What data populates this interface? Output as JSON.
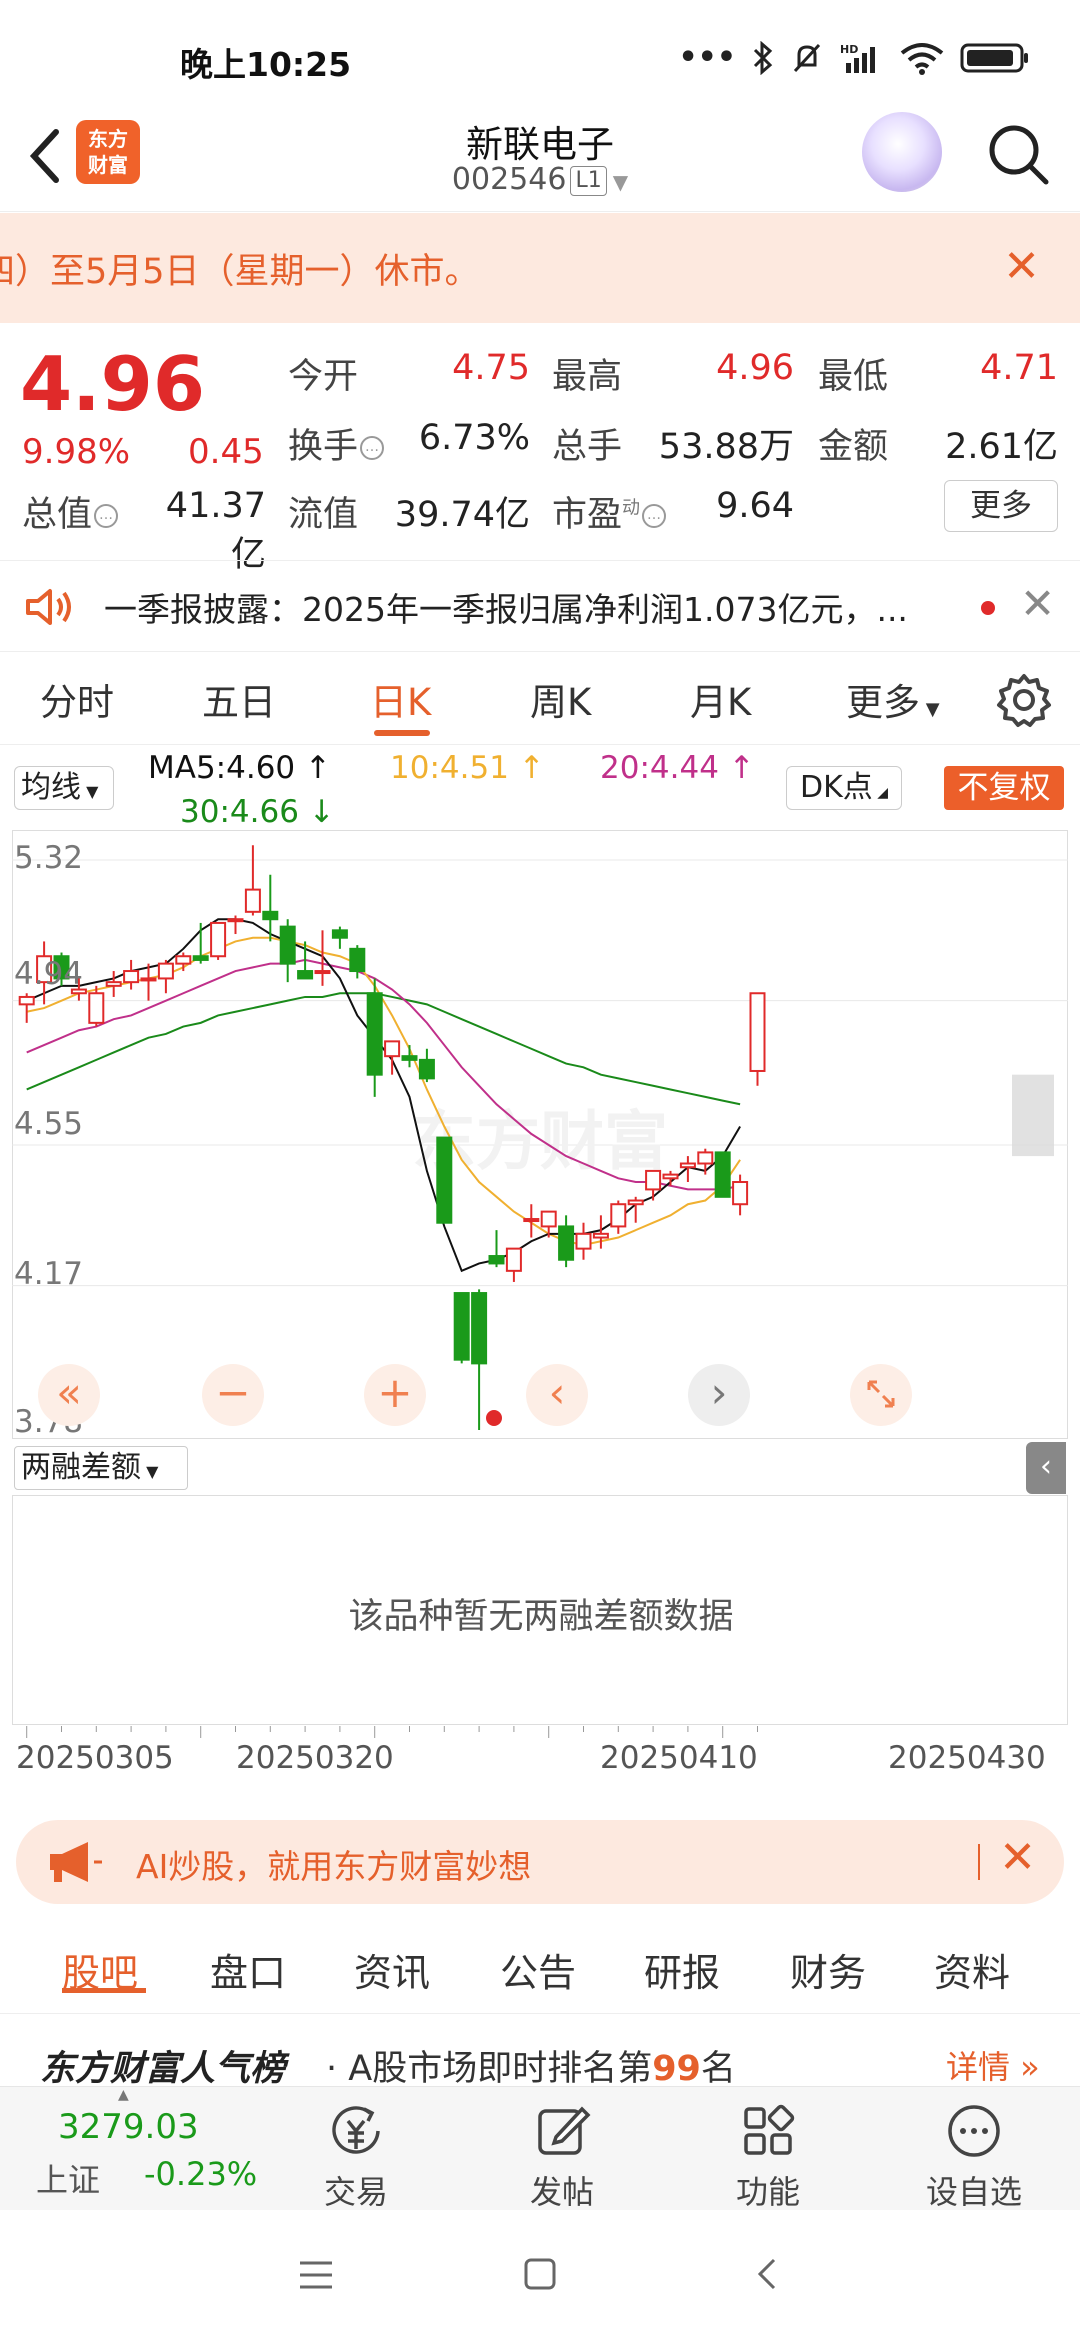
{
  "status": {
    "time": "晚上10:25"
  },
  "header": {
    "title": "新联电子",
    "code": "002546",
    "level": "L1",
    "logo_line1": "东方",
    "logo_line2": "财富"
  },
  "notice": {
    "text": "四）至5月5日（星期一）休市。"
  },
  "quote": {
    "price": "4.96",
    "change_pct": "9.98%",
    "change": "0.45",
    "open_label": "今开",
    "open": "4.75",
    "high_label": "最高",
    "high": "4.96",
    "low_label": "最低",
    "low": "4.71",
    "turnover_label": "换手",
    "turnover": "6.73%",
    "volume_label": "总手",
    "volume": "53.88万",
    "amount_label": "金额",
    "amount": "2.61亿",
    "mktcap_label": "总值",
    "mktcap": "41.37亿",
    "float_label": "流值",
    "float": "39.74亿",
    "pe_label": "市盈",
    "pe_sup": "动",
    "pe": "9.64",
    "more": "更多"
  },
  "news": {
    "text": "一季报披露：2025年一季报归属净利润1.073亿元，..."
  },
  "ktabs": [
    "分时",
    "五日",
    "日K",
    "周K",
    "月K",
    "更多"
  ],
  "ma": {
    "select": "均线",
    "ma5": "MA5:4.60 ↑",
    "ma10": "10:4.51 ↑",
    "ma20": "20:4.44 ↑",
    "ma30": "30:4.66 ↓",
    "dk": "DK点",
    "fq": "不复权"
  },
  "colors": {
    "up": "#e02a2a",
    "down": "#1a9a1a",
    "accent": "#e5602c",
    "ma5": "#111111",
    "ma10": "#f0b030",
    "ma20": "#c0308a",
    "ma30": "#1a8a1a"
  },
  "chart_data": {
    "type": "candlestick",
    "ylim": [
      3.78,
      5.32
    ],
    "y_ticks": [
      "5.32",
      "4.94",
      "4.55",
      "4.17",
      "3.78"
    ],
    "x_ticks": [
      "20250305",
      "20250320",
      "20250410",
      "20250430"
    ],
    "candles": [
      {
        "o": 4.93,
        "h": 4.96,
        "l": 4.88,
        "c": 4.95
      },
      {
        "o": 4.99,
        "h": 5.1,
        "l": 4.93,
        "c": 5.06
      },
      {
        "o": 5.06,
        "h": 5.07,
        "l": 4.98,
        "c": 5.0
      },
      {
        "o": 4.96,
        "h": 5.0,
        "l": 4.94,
        "c": 4.97
      },
      {
        "o": 4.88,
        "h": 4.98,
        "l": 4.87,
        "c": 4.96
      },
      {
        "o": 4.98,
        "h": 5.02,
        "l": 4.95,
        "c": 4.99
      },
      {
        "o": 4.99,
        "h": 5.05,
        "l": 4.97,
        "c": 5.02
      },
      {
        "o": 5.0,
        "h": 5.04,
        "l": 4.94,
        "c": 5.0
      },
      {
        "o": 5.0,
        "h": 5.05,
        "l": 4.96,
        "c": 5.04
      },
      {
        "o": 5.04,
        "h": 5.07,
        "l": 5.02,
        "c": 5.06
      },
      {
        "o": 5.06,
        "h": 5.15,
        "l": 5.04,
        "c": 5.05
      },
      {
        "o": 5.06,
        "h": 5.15,
        "l": 5.05,
        "c": 5.15
      },
      {
        "o": 5.16,
        "h": 5.17,
        "l": 5.12,
        "c": 5.16
      },
      {
        "o": 5.18,
        "h": 5.36,
        "l": 5.17,
        "c": 5.24
      },
      {
        "o": 5.18,
        "h": 5.28,
        "l": 5.1,
        "c": 5.16
      },
      {
        "o": 5.14,
        "h": 5.16,
        "l": 4.99,
        "c": 5.04
      },
      {
        "o": 5.02,
        "h": 5.1,
        "l": 5.0,
        "c": 5.0
      },
      {
        "o": 5.02,
        "h": 5.13,
        "l": 4.98,
        "c": 5.02
      },
      {
        "o": 5.13,
        "h": 5.14,
        "l": 5.08,
        "c": 5.11
      },
      {
        "o": 5.08,
        "h": 5.09,
        "l": 5.0,
        "c": 5.02
      },
      {
        "o": 4.96,
        "h": 5.0,
        "l": 4.68,
        "c": 4.74
      },
      {
        "o": 4.79,
        "h": 4.82,
        "l": 4.74,
        "c": 4.83
      },
      {
        "o": 4.79,
        "h": 4.82,
        "l": 4.76,
        "c": 4.78
      },
      {
        "o": 4.78,
        "h": 4.81,
        "l": 4.72,
        "c": 4.73
      },
      {
        "o": 4.57,
        "h": 4.57,
        "l": 4.34,
        "c": 4.34
      },
      {
        "o": 4.15,
        "h": 4.15,
        "l": 3.96,
        "c": 3.97
      },
      {
        "o": 4.15,
        "h": 4.16,
        "l": 3.78,
        "c": 3.96
      },
      {
        "o": 4.25,
        "h": 4.32,
        "l": 4.22,
        "c": 4.23
      },
      {
        "o": 4.21,
        "h": 4.27,
        "l": 4.18,
        "c": 4.27
      },
      {
        "o": 4.35,
        "h": 4.39,
        "l": 4.3,
        "c": 4.35
      },
      {
        "o": 4.33,
        "h": 4.37,
        "l": 4.3,
        "c": 4.37
      },
      {
        "o": 4.33,
        "h": 4.36,
        "l": 4.22,
        "c": 4.24
      },
      {
        "o": 4.27,
        "h": 4.34,
        "l": 4.24,
        "c": 4.31
      },
      {
        "o": 4.3,
        "h": 4.36,
        "l": 4.27,
        "c": 4.31
      },
      {
        "o": 4.33,
        "h": 4.4,
        "l": 4.31,
        "c": 4.39
      },
      {
        "o": 4.39,
        "h": 4.41,
        "l": 4.34,
        "c": 4.4
      },
      {
        "o": 4.43,
        "h": 4.48,
        "l": 4.4,
        "c": 4.48
      },
      {
        "o": 4.46,
        "h": 4.48,
        "l": 4.44,
        "c": 4.47
      },
      {
        "o": 4.49,
        "h": 4.52,
        "l": 4.45,
        "c": 4.5
      },
      {
        "o": 4.5,
        "h": 4.54,
        "l": 4.47,
        "c": 4.53
      },
      {
        "o": 4.53,
        "h": 4.53,
        "l": 4.41,
        "c": 4.41
      },
      {
        "o": 4.39,
        "h": 4.47,
        "l": 4.36,
        "c": 4.45
      },
      {
        "o": 4.75,
        "h": 4.96,
        "l": 4.71,
        "c": 4.96
      }
    ],
    "ma5": [
      4.94,
      4.96,
      4.98,
      4.98,
      4.99,
      5.0,
      5.02,
      5.03,
      5.04,
      5.08,
      5.13,
      5.16,
      5.16,
      5.15,
      5.12,
      5.1,
      5.08,
      5.06,
      5.0,
      4.9,
      4.84,
      4.78,
      4.68,
      4.48,
      4.33,
      4.21,
      4.23,
      4.24,
      4.26,
      4.29,
      4.31,
      4.31,
      4.31,
      4.32,
      4.35,
      4.39,
      4.41,
      4.45,
      4.49,
      4.48,
      4.52,
      4.6
    ],
    "ma10": [
      4.91,
      4.92,
      4.94,
      4.96,
      4.97,
      4.98,
      4.99,
      5.0,
      5.01,
      5.03,
      5.06,
      5.08,
      5.1,
      5.11,
      5.11,
      5.1,
      5.09,
      5.07,
      5.06,
      5.04,
      4.98,
      4.9,
      4.81,
      4.7,
      4.6,
      4.51,
      4.45,
      4.41,
      4.37,
      4.34,
      4.31,
      4.29,
      4.28,
      4.29,
      4.3,
      4.32,
      4.34,
      4.36,
      4.39,
      4.4,
      4.44,
      4.51
    ],
    "ma20": [
      4.8,
      4.82,
      4.84,
      4.86,
      4.87,
      4.89,
      4.9,
      4.92,
      4.94,
      4.96,
      4.98,
      5.0,
      5.02,
      5.03,
      5.04,
      5.04,
      5.05,
      5.04,
      5.03,
      5.02,
      5.0,
      4.97,
      4.93,
      4.88,
      4.82,
      4.76,
      4.71,
      4.66,
      4.62,
      4.58,
      4.55,
      4.52,
      4.5,
      4.48,
      4.46,
      4.45,
      4.45,
      4.44,
      4.43,
      4.43,
      4.43,
      4.44
    ],
    "ma30": [
      4.7,
      4.72,
      4.74,
      4.76,
      4.78,
      4.8,
      4.82,
      4.84,
      4.85,
      4.87,
      4.88,
      4.9,
      4.91,
      4.92,
      4.93,
      4.94,
      4.95,
      4.95,
      4.96,
      4.96,
      4.96,
      4.95,
      4.94,
      4.93,
      4.91,
      4.89,
      4.87,
      4.85,
      4.83,
      4.81,
      4.79,
      4.77,
      4.76,
      4.74,
      4.73,
      4.72,
      4.71,
      4.7,
      4.69,
      4.68,
      4.67,
      4.66
    ]
  },
  "margin": {
    "select": "两融差额",
    "empty": "该品种暂无两融差额数据"
  },
  "ad": {
    "text": "AI炒股，就用东方财富妙想"
  },
  "btabs": [
    "股吧",
    "盘口",
    "资讯",
    "公告",
    "研报",
    "财务",
    "资料"
  ],
  "rank": {
    "brand": "东方财富人气榜",
    "prefix": "· A股市场即时排名第",
    "num": "99",
    "suffix": "名",
    "detail": "详情 »"
  },
  "bottom_nav": {
    "index_value": "3279.03",
    "index_name": "上证",
    "index_change": "-0.23%",
    "trade": "交易",
    "post": "发帖",
    "func": "功能",
    "watch": "设自选"
  }
}
